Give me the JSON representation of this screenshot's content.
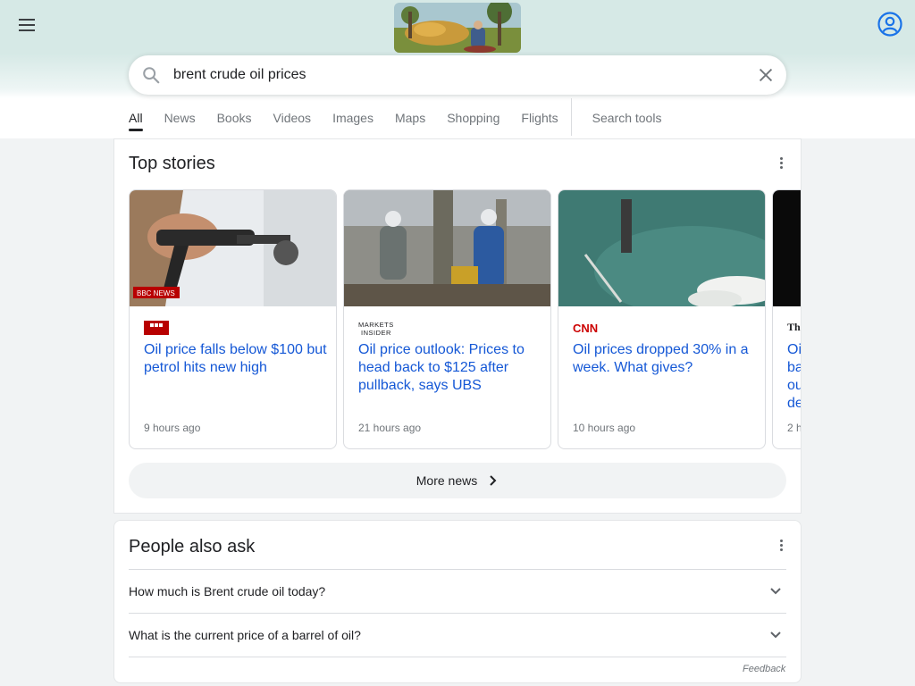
{
  "search": {
    "query": "brent crude oil prices"
  },
  "tabs": [
    "All",
    "News",
    "Books",
    "Videos",
    "Images",
    "Maps",
    "Shopping",
    "Flights"
  ],
  "search_tools_label": "Search tools",
  "top_stories": {
    "title": "Top stories",
    "stories": [
      {
        "source": "BBC NEWS",
        "logo_text": "BBC NEWS",
        "headline": "Oil price falls below $100 but petrol hits new high",
        "time": "9 hours ago"
      },
      {
        "source": "MARKETS INSIDER",
        "logo_text": "MARKETS INSIDER",
        "headline": "Oil price outlook: Prices to head back to $125 after pullback, says UBS",
        "time": "21 hours ago"
      },
      {
        "source": "CNN",
        "logo_text": "CNN",
        "headline": "Oil prices dropped 30% in a week. What gives?",
        "time": "10 hours ago"
      },
      {
        "source": "The",
        "logo_text": "The",
        "headline": "Oi ba ou de",
        "time": "2 h"
      }
    ],
    "more_news_label": "More news"
  },
  "people_also_ask": {
    "title": "People also ask",
    "questions": [
      "How much is Brent crude oil today?",
      "What is the current price of a barrel of oil?"
    ],
    "feedback_label": "Feedback"
  },
  "colors": {
    "link": "#1558d6",
    "bbc_red": "#b80000",
    "cnn_red": "#cc0000"
  }
}
